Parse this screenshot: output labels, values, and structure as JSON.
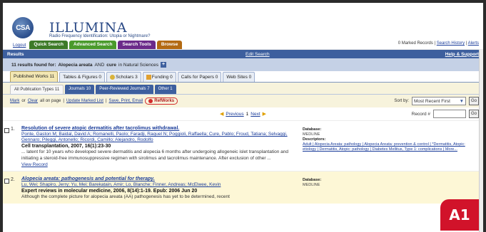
{
  "header": {
    "logo_text": "CSA",
    "brand": "ILLUMINA",
    "tagline": "Radio Frequency Identification: Utopia or Nightmare?",
    "top_links": {
      "logout": "Logout"
    },
    "tabs": [
      {
        "label": "Quick Search",
        "color": "#3d7a28"
      },
      {
        "label": "Advanced Search",
        "color": "#4a9a2c"
      },
      {
        "label": "Search Tools",
        "color": "#6b2a8a"
      },
      {
        "label": "Browse",
        "color": "#b36a12"
      }
    ],
    "marked_records": "0 Marked Records",
    "search_history": "Search History",
    "alerts": "Alerts"
  },
  "results_bar": {
    "label": "Results",
    "edit_search": "Edit Search",
    "help": "Help & Support"
  },
  "found_bar": {
    "count_text": "11 results found for:",
    "term1": "Alopecia areata",
    "and_text": "AND",
    "term2": "cure",
    "in_text": "in Natural Sciences",
    "plus": "+"
  },
  "work_tabs": [
    {
      "label": "Published Works 11",
      "active": true,
      "icon": ""
    },
    {
      "label": "Tables & Figures 0",
      "active": false,
      "icon": ""
    },
    {
      "label": "Scholars 3",
      "active": false,
      "icon": "scholars-icon"
    },
    {
      "label": "Funding 0",
      "active": false,
      "icon": "funding-icon"
    },
    {
      "label": "Calls for Papers 0",
      "active": false,
      "icon": ""
    },
    {
      "label": "Web Sites 0",
      "active": false,
      "icon": ""
    }
  ],
  "pub_tabs": [
    {
      "label": "All Publication Types 11",
      "active": true
    },
    {
      "label": "Journals 10",
      "active": false
    },
    {
      "label": "Peer-Reviewed Journals 7",
      "active": false
    },
    {
      "label": "Other 1",
      "active": false
    }
  ],
  "actions": {
    "mark": "Mark",
    "or": "or",
    "clear": "Clear",
    "all_on_page": "all on page",
    "update": "Update Marked List",
    "save": "Save, Print, Email",
    "refworks": "RefWorks",
    "sort_label": "Sort by:",
    "sort_value": "Most Recent First",
    "go": "Go"
  },
  "pager": {
    "previous": "Previous",
    "page": "1",
    "next": "Next",
    "record_label": "Record #",
    "go": "Go"
  },
  "results": [
    {
      "num": "1.",
      "title": "Resolution of severe atopic dermatitis after tacrolimus withdrawal.",
      "authors": "Ponte, Gaston M; Baidal, David A; Romanelli, Paolo; Faradji, Raquel N; Poggioli, Raffaella; Cure, Pablo; Froud, Tatiana; Selvaggi, Gennaro; Pileggi, Antonello; Ricordi, Camillo; Alejandro, Rodolfo",
      "source": "Cell transplantation, 2007, 16(1):23-30",
      "snippet": "... latent for 10 years who developed severe dermatitis and alopecia 6 months after undergoing allogeneic islet transplantation and initiating a steroid-free immunosuppressive regimen with sirolimus and tacrolimus maintenance. After exclusion of other ...",
      "view": "View Record",
      "database_label": "Database:",
      "database": "MEDLINE",
      "descriptors_label": "Descriptors:",
      "descriptors": "Adult | Alopecia Areata: pathology | Alopecia Areata: prevention & control | *Dermatitis, Atopic: etiology | Dermatitis, Atopic: pathology | Diabetes Mellitus, Type 1: complications | More..."
    },
    {
      "num": "2.",
      "title": "Alopecia areata: pathogenesis and potential for therapy.",
      "authors": "Lu, Wei; Shapiro, Jerry; Yu, Mei; Barekatain, Amir; Lo, Blanche; Finner, Andreas; McElwee, Kevin",
      "source": "Expert reviews in molecular medicine, 2006, 8(14):1-19. Epub: 2006 Jun 20",
      "snippet": "Although the complete picture for alopecia areata (AA) pathogenesis has yet to be determined, recent",
      "view": "",
      "database_label": "Database:",
      "database": "MEDLINE",
      "descriptors_label": "",
      "descriptors": ""
    }
  ],
  "badge": "A1"
}
